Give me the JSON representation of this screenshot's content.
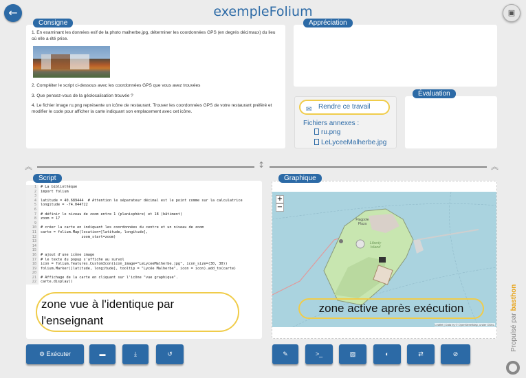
{
  "app": {
    "title": "exempleFolium"
  },
  "consigne": {
    "tag": "Consigne",
    "p1": "1. En examinant les données exif de la photo malherbe.jpg, déterminer les coordonnées GPS (en degrés décimaux) du lieu où elle a été prise.",
    "p2": "2. Compléter le script ci-dessous avec les coordonnées GPS que vous avez trouvées",
    "p3": "3. Que pensez-vous de la géolocalisation trouvée ?",
    "p4": "4. Le fichier image ru.png représente un icône de restaurant. Trouver les coordonnées GPS de votre restaurant préféré et modifier le code pour afficher la carte indiquant son emplacement avec cet icône."
  },
  "appreciation": {
    "tag": "Appréciation"
  },
  "evaluation": {
    "tag": "Évaluation"
  },
  "render": {
    "button": "Rendre ce travail",
    "annex_title": "Fichiers annexes :",
    "files": [
      "ru.png",
      "LeLyceeMalherbe.jpg"
    ]
  },
  "script": {
    "tag": "Script",
    "line_numbers": "1\n2\n3\n4\n5\n6\n7\n8\n9\n10\n11\n12\n13\n14\n15\n16\n17\n18\n19\n20\n21\n22",
    "code": "# La bibliothèque\nimport folium\n\nlatitude = 40.689444  # Attention le séparateur décimal est le point comme sur la calculatrice\nlongitude = -74.044722\n\n# définir le niveau de zoom entre 1 (planisphère) et 18 (bâtiment)\nzoom = 17\n\n# créer la carte en indiquant les coordonnées du centre et un niveau de zoom\ncarte = folium.Map(location=[latitude, longitude],\n                   zoom_start=zoom)\n\n\n\n# ajout d'une icône image\n# le texte du popup s'affiche au survol\nicon = folium.features.CustomIcon(icon_image=\"LeLyceeMalherbe.jpg\", icon_size=(30, 30))\nfolium.Marker([latitude, longitude], tooltip = \"Lycée Malherbe\", icon = icon).add_to(carte)\n\n# Affichage de la carte en cliquant sur l'icône \"vue graphique\".\ncarte.display()"
  },
  "graph": {
    "tag": "Graphique",
    "zoom_in": "+",
    "zoom_out": "−",
    "labels": {
      "flagpole": "Flagpole Plaza",
      "liberty": "Liberty Island"
    },
    "attribution": "Leaflet | Data by © OpenStreetMap, under ODbL."
  },
  "annotations": {
    "left": "zone vue à l'identique par l'enseignant",
    "right": "zone active après exécution"
  },
  "toolbar": {
    "execute": "Exécuter"
  },
  "brand": {
    "prefix": "Propulsé par ",
    "name": "basthon"
  },
  "colors": {
    "accent": "#2c6aa6",
    "highlight": "#f0cc4a",
    "water": "#aad3df",
    "land": "#c8e6b0"
  },
  "icons": [
    "back-arrow-icon",
    "save-icon",
    "send-icon",
    "file-icon",
    "gear-icon",
    "folder-icon",
    "download-icon",
    "undo-icon",
    "brush-icon",
    "terminal-icon",
    "image-icon",
    "contrast-icon",
    "swap-icon",
    "eye-off-icon",
    "lifebuoy-icon"
  ]
}
